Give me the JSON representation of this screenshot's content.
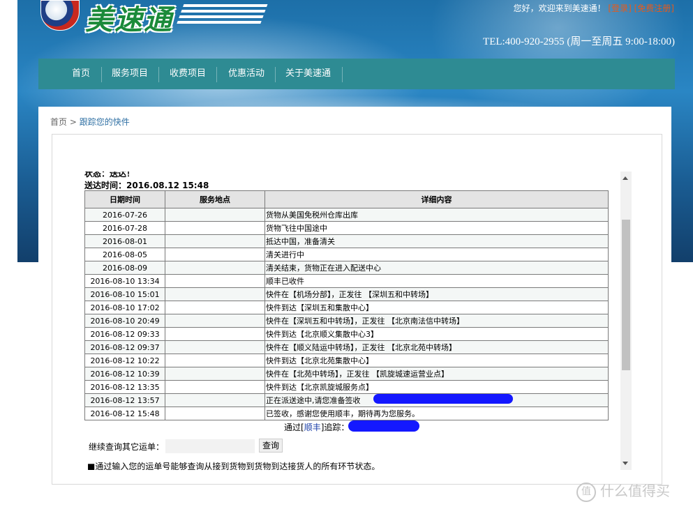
{
  "header": {
    "logo_text": "美速通",
    "logo_badge": "mst",
    "welcome": "您好，欢迎来到美速通！",
    "login_link": "[登录]",
    "register_link": "[免费注册]",
    "tel": "TEL:400-920-2955 (周一至周五 9:00-18:00)"
  },
  "nav": {
    "items": [
      {
        "label": "首页"
      },
      {
        "label": "服务项目"
      },
      {
        "label": "收费项目"
      },
      {
        "label": "优惠活动"
      },
      {
        "label": "关于美速通"
      }
    ]
  },
  "breadcrumb": {
    "home": "首页",
    "separator": ">",
    "current": "跟踪您的快件"
  },
  "tracking": {
    "status_line_clipped": "状态：送达！",
    "delivery_time": "送达时间：2016.08.12 15:48",
    "columns": [
      "日期时间",
      "服务地点",
      "详细内容"
    ],
    "rows": [
      {
        "time": "2016-07-26",
        "place": "",
        "detail": "货物从美国免税州仓库出库"
      },
      {
        "time": "2016-07-28",
        "place": "",
        "detail": "货物飞往中国途中"
      },
      {
        "time": "2016-08-01",
        "place": "",
        "detail": "抵达中国，准备清关"
      },
      {
        "time": "2016-08-05",
        "place": "",
        "detail": "清关进行中"
      },
      {
        "time": "2016-08-09",
        "place": "",
        "detail": "清关结束，货物正在进入配送中心"
      },
      {
        "time": "2016-08-10 13:34",
        "place": "",
        "detail": "顺丰已收件"
      },
      {
        "time": "2016-08-10 15:01",
        "place": "",
        "detail": "快件在【机场分部】，正发往 【深圳五和中转场】"
      },
      {
        "time": "2016-08-10 17:02",
        "place": "",
        "detail": "快件到达【深圳五和集散中心】"
      },
      {
        "time": "2016-08-10 20:49",
        "place": "",
        "detail": "快件在【深圳五和中转场】，正发往 【北京南法信中转场】"
      },
      {
        "time": "2016-08-12 09:33",
        "place": "",
        "detail": "快件到达【北京顺义集散中心3】"
      },
      {
        "time": "2016-08-12 09:37",
        "place": "",
        "detail": "快件在【顺义陆运中转场】，正发往 【北京北苑中转场】"
      },
      {
        "time": "2016-08-12 10:22",
        "place": "",
        "detail": "快件到达【北京北苑集散中心】"
      },
      {
        "time": "2016-08-12 10:39",
        "place": "",
        "detail": "快件在【北苑中转场】，正发往 【凯旋城速运营业点】"
      },
      {
        "time": "2016-08-12 13:35",
        "place": "",
        "detail": "快件到达【北京凯旋城服务点】"
      },
      {
        "time": "2016-08-12 13:57",
        "place": "",
        "detail": "正在派送途中,请您准备签收"
      },
      {
        "time": "2016-08-12 15:48",
        "place": "",
        "detail": "已签收，感谢您使用顺丰，期待再为您服务。"
      }
    ],
    "via_prefix": "通过[",
    "via_carrier": "顺丰",
    "via_suffix": "]追踪：",
    "continue_label": "继续查询其它运单：",
    "query_button": "查询",
    "note": "■通过输入您的运单号能够查询从接到货物到货物到达接货人的所有环节状态。"
  },
  "watermark": {
    "icon": "值",
    "text": "什么值得买"
  },
  "colors": {
    "nav_bg": "#2e8b93",
    "link_orange": "#e85a1a",
    "redaction": "#1418ff"
  }
}
